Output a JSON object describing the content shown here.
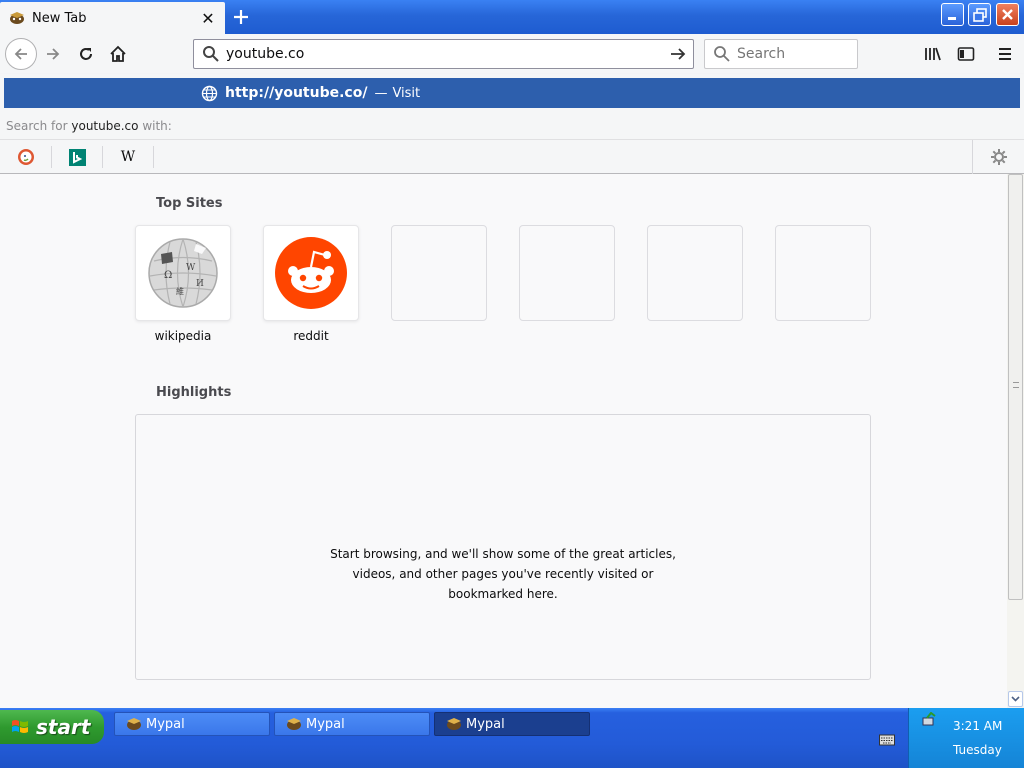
{
  "tab": {
    "title": "New Tab",
    "close_icon": "close-icon"
  },
  "window": {
    "minimize": "minimize-icon",
    "maximize": "restore-icon",
    "close": "close-icon"
  },
  "nav": {
    "url_value": "youtube.co",
    "search_placeholder": "Search"
  },
  "popup": {
    "suggestion_url": "http://youtube.co/",
    "suggestion_separator": "—",
    "suggestion_action": "Visit",
    "search_for_prefix": "Search for",
    "search_for_query": "youtube.co",
    "search_for_suffix": "with:",
    "engines": [
      "duckduckgo-icon",
      "bing-icon",
      "wikipedia-icon"
    ],
    "wiki_glyph": "W"
  },
  "content": {
    "topsites_title": "Top Sites",
    "sites": [
      {
        "label": "wikipedia",
        "icon": "wikipedia-globe-icon"
      },
      {
        "label": "reddit",
        "icon": "reddit-icon"
      },
      {
        "label": "",
        "icon": ""
      },
      {
        "label": "",
        "icon": ""
      },
      {
        "label": "",
        "icon": ""
      },
      {
        "label": "",
        "icon": ""
      }
    ],
    "highlights_title": "Highlights",
    "highlights_message": "Start browsing, and we'll show some of the great articles, videos, and other pages you've recently visited or bookmarked here."
  },
  "taskbar": {
    "start_label": "start",
    "tasks": [
      {
        "label": "Mypal",
        "active": false
      },
      {
        "label": "Mypal",
        "active": false
      },
      {
        "label": "Mypal",
        "active": true
      }
    ],
    "clock_time": "3:21 AM",
    "clock_day": "Tuesday"
  },
  "colors": {
    "accent": "#2d5fad",
    "reddit": "#ff4500",
    "taskbar": "#235bd8",
    "start": "#2f9a2f"
  }
}
